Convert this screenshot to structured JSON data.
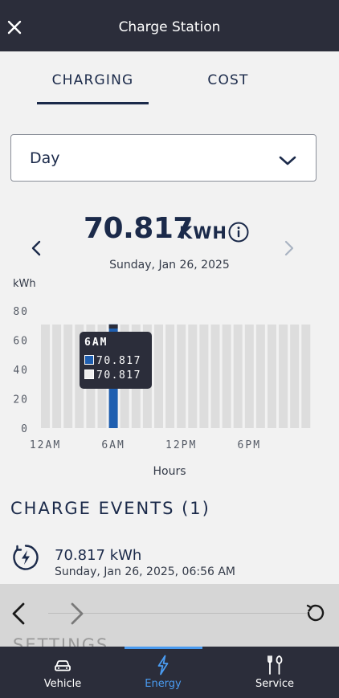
{
  "header": {
    "title": "Charge Station",
    "close_icon": "close-icon"
  },
  "tabs": [
    {
      "label": "CHARGING",
      "active": true
    },
    {
      "label": "COST",
      "active": false
    }
  ],
  "period_select": {
    "value": "Day",
    "icon": "chevron-down-icon"
  },
  "summary": {
    "value": "70.817",
    "unit": "KWH",
    "date": "Sunday, Jan 26, 2025",
    "info_icon": "info-icon",
    "prev_icon": "chevron-left-icon",
    "next_icon": "chevron-right-icon"
  },
  "chart": {
    "unit_label": "kWh",
    "xlabel": "Hours",
    "tooltip": {
      "title": "6AM",
      "rows": [
        "70.817",
        "70.817"
      ]
    }
  },
  "chart_data": {
    "type": "bar",
    "ylabel": "kWh",
    "xlabel": "Hours",
    "ylim": [
      0,
      80
    ],
    "yticks": [
      0,
      20,
      40,
      60,
      80
    ],
    "xtick_labels": [
      "12AM",
      "6AM",
      "12PM",
      "6PM"
    ],
    "xtick_hours": [
      0,
      6,
      12,
      18
    ],
    "hours": [
      0,
      1,
      2,
      3,
      4,
      5,
      6,
      7,
      8,
      9,
      10,
      11,
      12,
      13,
      14,
      15,
      16,
      17,
      18,
      19,
      20,
      21,
      22,
      23
    ],
    "values": [
      0,
      0,
      0,
      0,
      0,
      0,
      70.817,
      0,
      0,
      0,
      0,
      0,
      0,
      0,
      0,
      0,
      0,
      0,
      0,
      0,
      0,
      0,
      0,
      0
    ],
    "selected_hour": 6,
    "colors": {
      "background_bar": "#dddddd",
      "value_bar": "#1f5fb0",
      "selected_cap": "#2b2d3a"
    }
  },
  "events": {
    "heading": "CHARGE EVENTS (1)",
    "items": [
      {
        "value": "70.817 kWh",
        "date": "Sunday, Jan 26, 2025, 06:56 AM",
        "icon": "charging-bolt-icon"
      }
    ]
  },
  "browser_bar": {
    "peek_text": "SETTINGS",
    "back_icon": "back-arrow-icon",
    "forward_icon": "forward-arrow-icon",
    "reload_icon": "reload-icon"
  },
  "bottom_nav": {
    "items": [
      {
        "label": "Vehicle",
        "icon": "car-icon",
        "active": false
      },
      {
        "label": "Energy",
        "icon": "lightning-icon",
        "active": true
      },
      {
        "label": "Service",
        "icon": "tools-icon",
        "active": false
      }
    ]
  },
  "colors": {
    "navy": "#1b2a4a",
    "dark_bar": "#2b2d3a",
    "accent_blue": "#4a9bf0"
  }
}
